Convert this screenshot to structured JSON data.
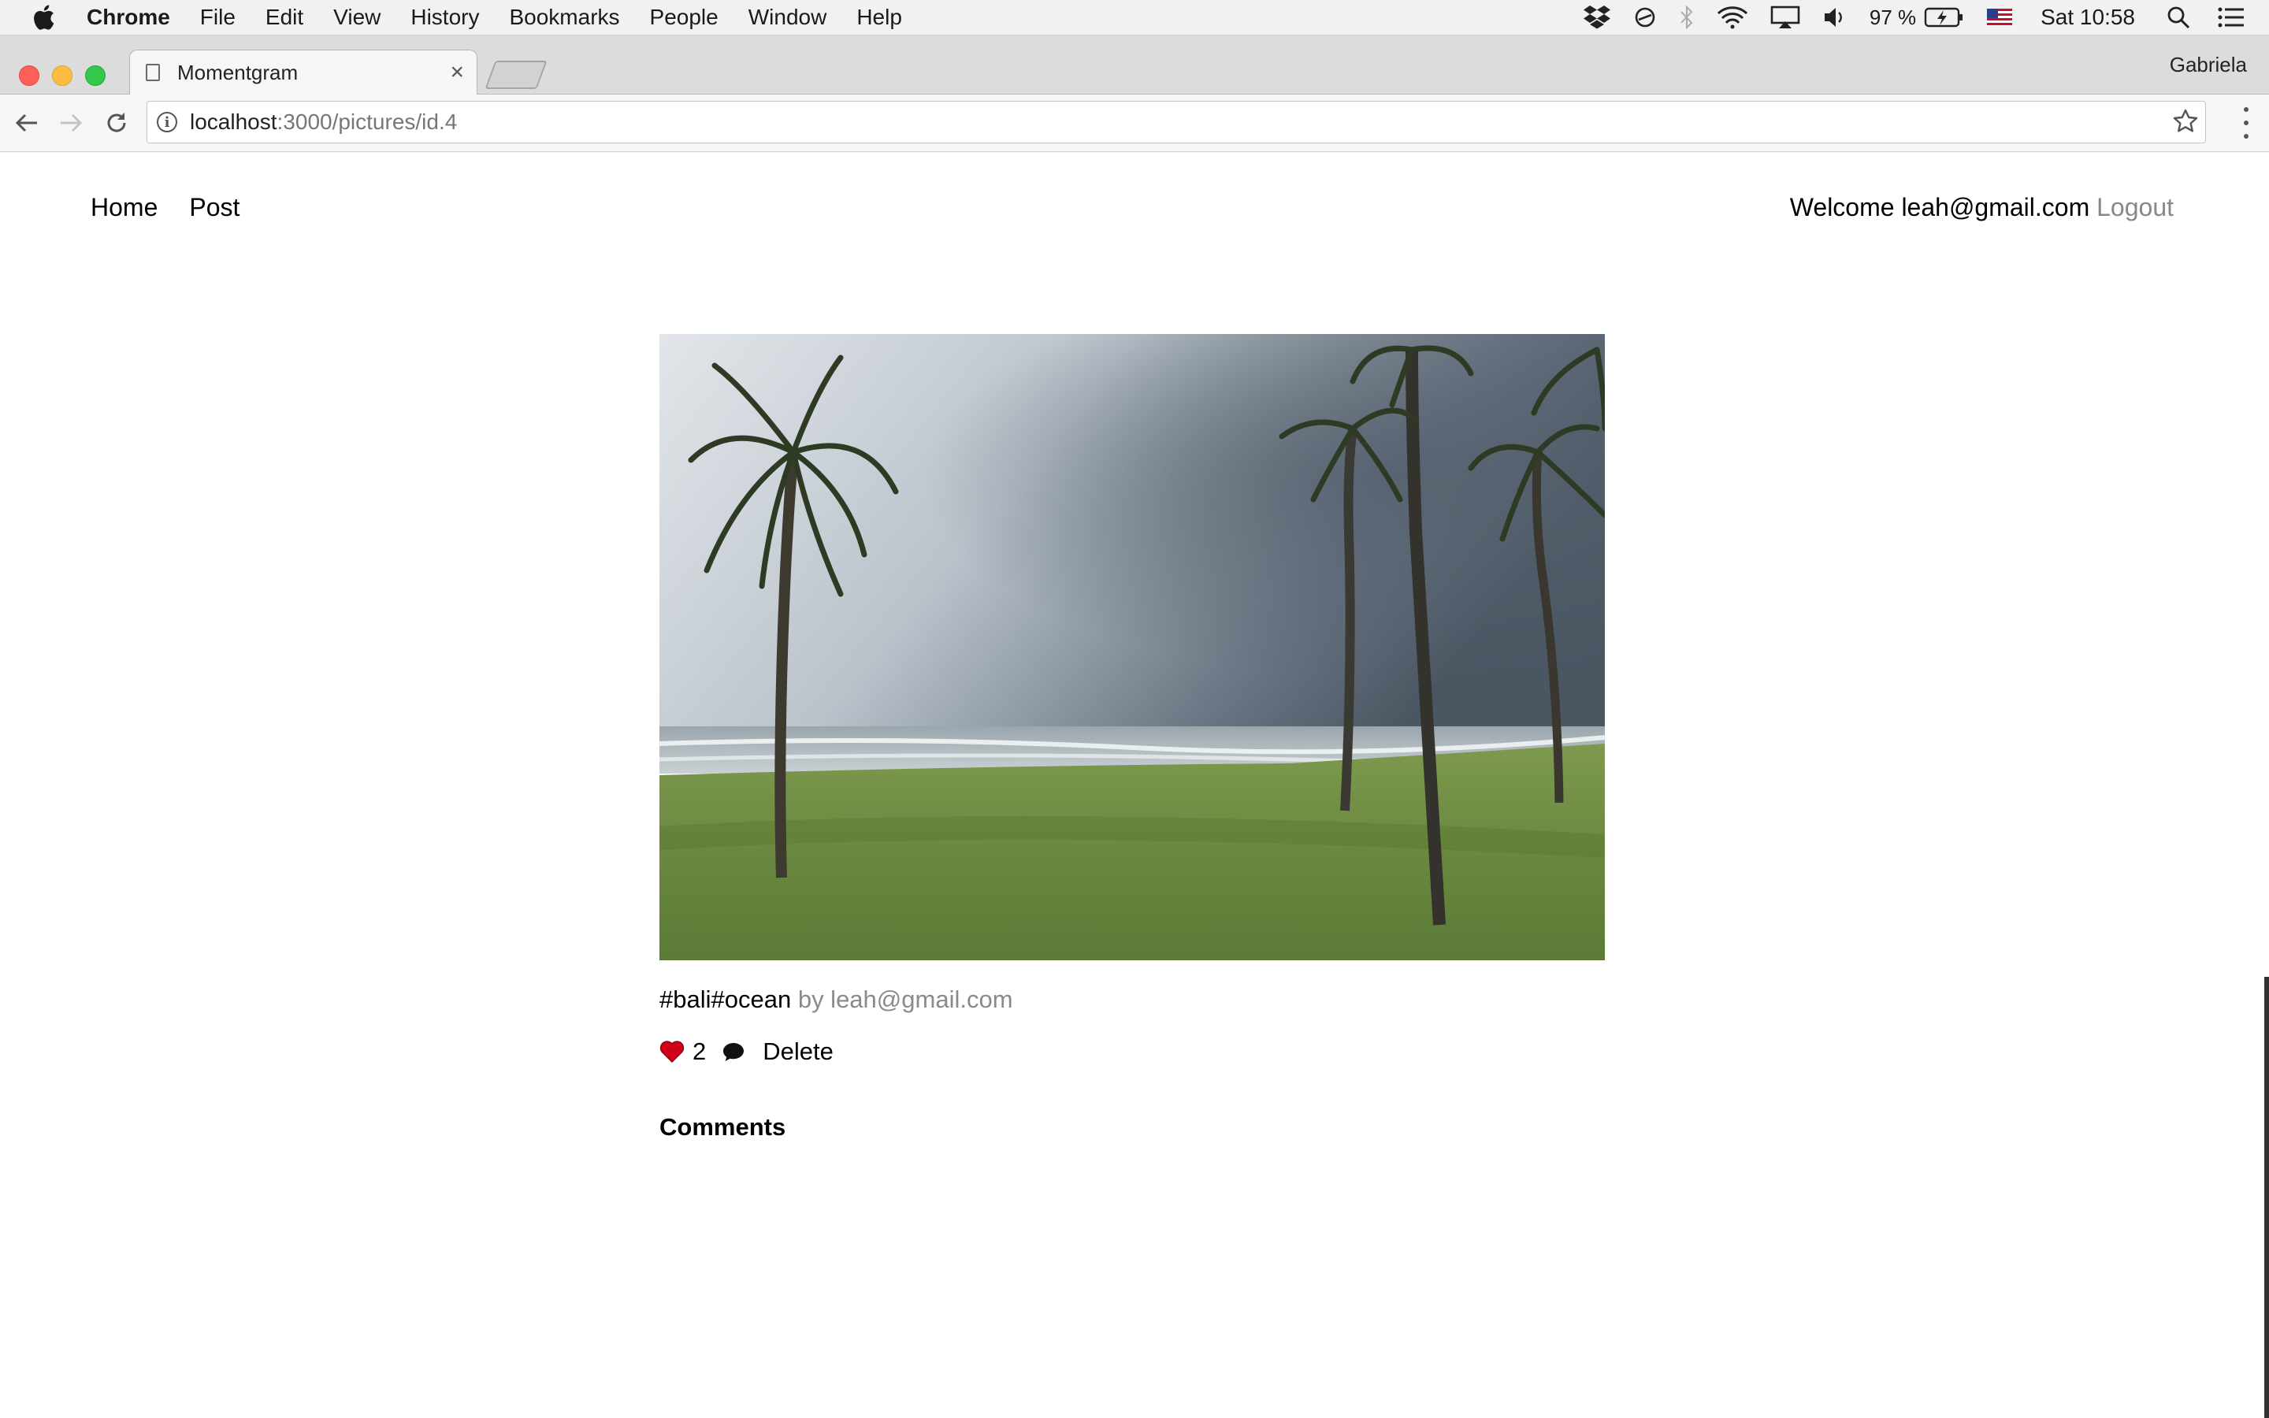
{
  "menubar": {
    "app": "Chrome",
    "items": [
      "File",
      "Edit",
      "View",
      "History",
      "Bookmarks",
      "People",
      "Window",
      "Help"
    ],
    "battery": "97 %",
    "clock": "Sat 10:58"
  },
  "browser": {
    "tab_title": "Momentgram",
    "tab_close": "×",
    "profile": "Gabriela",
    "url_host": "localhost",
    "url_path": ":3000/pictures/id.4"
  },
  "nav": {
    "home": "Home",
    "post": "Post",
    "welcome": "Welcome leah@gmail.com",
    "logout": "Logout"
  },
  "picture": {
    "tags": "#bali#ocean",
    "author": "by leah@gmail.com",
    "likes": "2",
    "delete_label": "Delete",
    "comments_heading": "Comments"
  },
  "colors": {
    "link_muted": "#888888",
    "heart": "#d0021b"
  }
}
